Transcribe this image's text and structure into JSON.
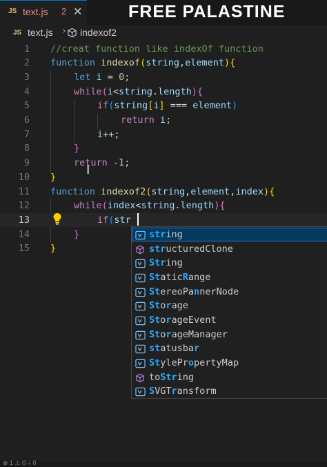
{
  "tab": {
    "lang_badge": "JS",
    "filename": "text.js",
    "problem_count": "2",
    "close_glyph": "✕"
  },
  "overlay_text": "FREE PALASTINE",
  "breadcrumb": {
    "lang_badge": "JS",
    "file": "text.js",
    "separator": "›",
    "symbol": "indexof2",
    "symbol_icon": "cube-icon"
  },
  "editor": {
    "current_line": 13,
    "lines": [
      {
        "n": "1",
        "tokens": [
          [
            "cm",
            "//creat function like indexOf function"
          ]
        ]
      },
      {
        "n": "2",
        "tokens": [
          [
            "kw",
            "function"
          ],
          [
            "p",
            " "
          ],
          [
            "fn",
            "indexof"
          ],
          [
            "b1",
            "("
          ],
          [
            "pa",
            "string"
          ],
          [
            "p",
            ","
          ],
          [
            "pa",
            "element"
          ],
          [
            "b1",
            ")"
          ],
          [
            "b1",
            "{"
          ]
        ]
      },
      {
        "n": "3",
        "tokens": [
          [
            "kw",
            "let"
          ],
          [
            "p",
            " "
          ],
          [
            "pa",
            "i"
          ],
          [
            "p",
            " = "
          ],
          [
            "num",
            "0"
          ],
          [
            "p",
            ";"
          ]
        ]
      },
      {
        "n": "4",
        "tokens": [
          [
            "ctl",
            "while"
          ],
          [
            "b2",
            "("
          ],
          [
            "pa",
            "i"
          ],
          [
            "p",
            "<"
          ],
          [
            "pa",
            "string"
          ],
          [
            "p",
            "."
          ],
          [
            "pa",
            "length"
          ],
          [
            "b2",
            ")"
          ],
          [
            "b2",
            "{"
          ]
        ]
      },
      {
        "n": "5",
        "tokens": [
          [
            "ctl",
            "if"
          ],
          [
            "b3",
            "("
          ],
          [
            "pa",
            "string"
          ],
          [
            "b1",
            "["
          ],
          [
            "pa",
            "i"
          ],
          [
            "b1",
            "]"
          ],
          [
            "p",
            " === "
          ],
          [
            "pa",
            "element"
          ],
          [
            "b3",
            ")"
          ]
        ]
      },
      {
        "n": "6",
        "tokens": [
          [
            "ctl",
            "return"
          ],
          [
            "p",
            " "
          ],
          [
            "pa",
            "i"
          ],
          [
            "p",
            ";"
          ]
        ]
      },
      {
        "n": "7",
        "tokens": [
          [
            "pa",
            "i"
          ],
          [
            "p",
            "++;"
          ]
        ]
      },
      {
        "n": "8",
        "tokens": [
          [
            "b2",
            "}"
          ]
        ]
      },
      {
        "n": "9",
        "tokens": [
          [
            "ctl",
            "return"
          ],
          [
            "p",
            " -"
          ],
          [
            "num",
            "1"
          ],
          [
            "p",
            ";"
          ]
        ]
      },
      {
        "n": "10",
        "tokens": [
          [
            "b1",
            "}"
          ]
        ]
      },
      {
        "n": "11",
        "tokens": [
          [
            "kw",
            "function"
          ],
          [
            "p",
            " "
          ],
          [
            "fn",
            "indexof2"
          ],
          [
            "b1",
            "("
          ],
          [
            "pa",
            "string"
          ],
          [
            "p",
            ","
          ],
          [
            "pa",
            "element"
          ],
          [
            "p",
            ","
          ],
          [
            "pa",
            "index"
          ],
          [
            "b1",
            ")"
          ],
          [
            "b1",
            "{"
          ]
        ]
      },
      {
        "n": "12",
        "tokens": [
          [
            "ctl",
            "while"
          ],
          [
            "b2",
            "("
          ],
          [
            "pa",
            "index"
          ],
          [
            "p",
            "<"
          ],
          [
            "pa",
            "string"
          ],
          [
            "p",
            "."
          ],
          [
            "pa",
            "length"
          ],
          [
            "b2",
            ")"
          ],
          [
            "b2",
            "{"
          ]
        ]
      },
      {
        "n": "13",
        "tokens": [
          [
            "ctl",
            "if"
          ],
          [
            "b3",
            "("
          ],
          [
            "pa",
            "str"
          ]
        ]
      },
      {
        "n": "14",
        "tokens": [
          [
            "b2",
            "}"
          ]
        ]
      },
      {
        "n": "15",
        "tokens": [
          [
            "b1",
            "}"
          ]
        ]
      }
    ]
  },
  "suggestions": {
    "query": "str",
    "selected_index": 0,
    "items": [
      {
        "icon": "variable-icon",
        "label": "string",
        "hl": [
          [
            0,
            3
          ]
        ]
      },
      {
        "icon": "method-cube-icon",
        "label": "structuredClone",
        "hl": [
          [
            0,
            3
          ]
        ]
      },
      {
        "icon": "variable-icon",
        "label": "String",
        "hl": [
          [
            0,
            3
          ]
        ]
      },
      {
        "icon": "variable-icon",
        "label": "StaticRange",
        "hl": [
          [
            0,
            2
          ],
          [
            6,
            7
          ]
        ]
      },
      {
        "icon": "variable-icon",
        "label": "StereoPannerNode",
        "hl": [
          [
            0,
            2
          ],
          [
            8,
            9
          ]
        ]
      },
      {
        "icon": "variable-icon",
        "label": "Storage",
        "hl": [
          [
            0,
            2
          ],
          [
            3,
            4
          ]
        ]
      },
      {
        "icon": "variable-icon",
        "label": "StorageEvent",
        "hl": [
          [
            0,
            2
          ],
          [
            3,
            4
          ]
        ]
      },
      {
        "icon": "variable-icon",
        "label": "StorageManager",
        "hl": [
          [
            0,
            2
          ],
          [
            3,
            4
          ]
        ]
      },
      {
        "icon": "variable-icon",
        "label": "statusbar",
        "hl": [
          [
            0,
            2
          ],
          [
            8,
            9
          ]
        ]
      },
      {
        "icon": "variable-icon",
        "label": "StylePropertyMap",
        "hl": [
          [
            0,
            1
          ],
          [
            1,
            2
          ],
          [
            7,
            8
          ]
        ]
      },
      {
        "icon": "method-cube-icon",
        "label": "toString",
        "hl": [
          [
            2,
            5
          ]
        ]
      },
      {
        "icon": "variable-icon",
        "label": "SVGTransform",
        "hl": [
          [
            0,
            1
          ],
          [
            4,
            5
          ]
        ]
      }
    ]
  },
  "status_bar": {
    "text": "⊗ 1 ⚠ 0   ⑃ 0"
  },
  "colors": {
    "keyword": "#569cd6",
    "control": "#c586c0",
    "function": "#dcdcaa",
    "variable": "#9cdcfe",
    "number": "#b5cea8",
    "comment": "#6a9955",
    "bracket_1": "#ffd700",
    "bracket_2": "#da70d6",
    "bracket_3": "#179fff",
    "suggest_highlight": "#2aaaff",
    "selected_bg": "#04395e"
  }
}
